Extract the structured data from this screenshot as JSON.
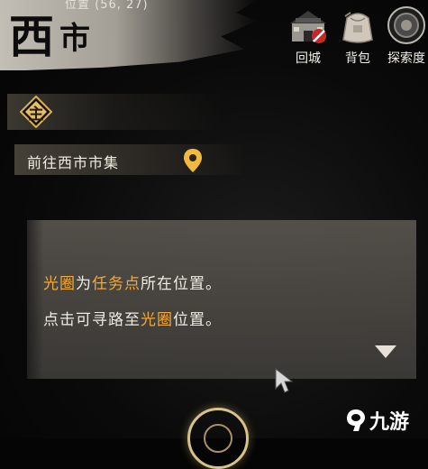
{
  "header": {
    "position_text": "位置 (56, 27)",
    "city_char1": "西",
    "city_char2": "市"
  },
  "top_buttons": [
    {
      "label": "回城",
      "icon": "return-city-icon"
    },
    {
      "label": "背包",
      "icon": "backpack-icon"
    },
    {
      "label": "探索度",
      "icon": "explore-icon"
    }
  ],
  "quest": {
    "type_label": "主",
    "title": "前往西市市集",
    "pin_icon": "map-pin-icon"
  },
  "tip": {
    "line1": {
      "hl1": "光圈",
      "t1": "为",
      "hl2": "任务点",
      "t2": "所在位置。"
    },
    "line2": {
      "t1": "点击可寻路至",
      "hl1": "光圈",
      "t2": "位置。"
    }
  },
  "watermark": {
    "text": "九游"
  },
  "colors": {
    "highlight": "#f0a93a",
    "gold": "#e2c06a",
    "panel": "#56524c"
  }
}
